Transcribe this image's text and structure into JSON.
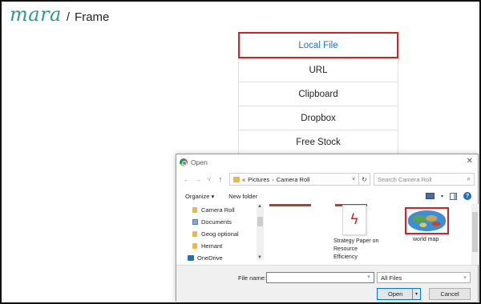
{
  "app": {
    "logo_text": "mara",
    "breadcrumb_separator": "/",
    "breadcrumb": "Frame"
  },
  "source_menu": {
    "items": [
      "Local File",
      "URL",
      "Clipboard",
      "Dropbox",
      "Free Stock"
    ],
    "active_index": 0,
    "accent_color": "#d42027",
    "active_text_color": "#1a73c8"
  },
  "dialog": {
    "title": "Open",
    "address": {
      "path": [
        "Pictures",
        "Camera Roll"
      ],
      "prefix": "«"
    },
    "search": {
      "placeholder": "Search Camera Roll"
    },
    "toolbar": {
      "organize": "Organize ▾",
      "new_folder": "New folder"
    },
    "nav": [
      {
        "label": "Camera Roll",
        "icon": "folder-icon"
      },
      {
        "label": "Documents",
        "icon": "documents-icon"
      },
      {
        "label": "Geog optional",
        "icon": "folder-icon"
      },
      {
        "label": "Hemant",
        "icon": "folder-icon"
      },
      {
        "label": "OneDrive",
        "icon": "onedrive-icon"
      }
    ],
    "files": [
      {
        "name": "Strategy Paper on Resource Efficiency",
        "icon": "pdf-icon"
      },
      {
        "name": "world map",
        "icon": "image-thumbnail",
        "selected": true
      }
    ],
    "footer": {
      "filename_label": "File name:",
      "filename_value": "",
      "filter": "All Files",
      "open_label": "Open",
      "cancel_label": "Cancel"
    }
  }
}
